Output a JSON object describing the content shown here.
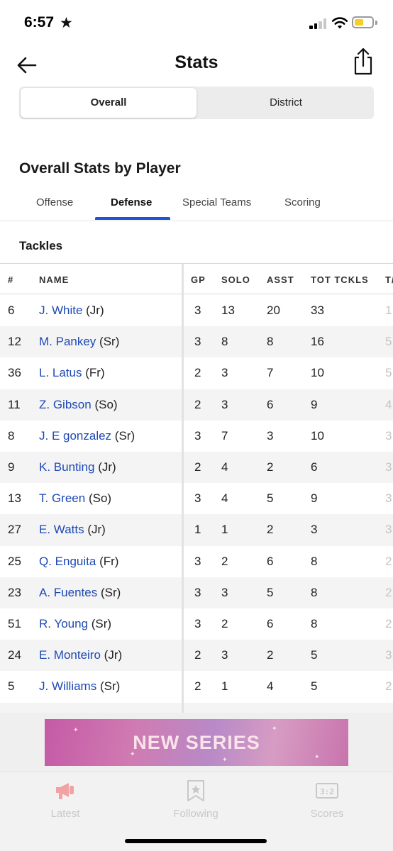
{
  "status": {
    "time": "6:57"
  },
  "nav": {
    "title": "Stats"
  },
  "segments": {
    "active": "Overall",
    "inactive": "District"
  },
  "section_title": "Overall Stats by Player",
  "tabs": [
    {
      "label": "Offense"
    },
    {
      "label": "Defense"
    },
    {
      "label": "Special Teams"
    },
    {
      "label": "Scoring"
    }
  ],
  "subsection": "Tackles",
  "table": {
    "headers": {
      "num": "#",
      "name": "NAME",
      "gp": "GP",
      "solo": "SOLO",
      "asst": "ASST",
      "tot": "TOT TCKLS",
      "clipped": "T/"
    },
    "rows": [
      {
        "num": "6",
        "name": "J. White",
        "yr": "(Jr)",
        "gp": "3",
        "solo": "13",
        "asst": "20",
        "tot": "33",
        "clipped": "1"
      },
      {
        "num": "12",
        "name": "M. Pankey",
        "yr": "(Sr)",
        "gp": "3",
        "solo": "8",
        "asst": "8",
        "tot": "16",
        "clipped": "5"
      },
      {
        "num": "36",
        "name": "L. Latus",
        "yr": "(Fr)",
        "gp": "2",
        "solo": "3",
        "asst": "7",
        "tot": "10",
        "clipped": "5"
      },
      {
        "num": "11",
        "name": "Z. Gibson",
        "yr": "(So)",
        "gp": "2",
        "solo": "3",
        "asst": "6",
        "tot": "9",
        "clipped": "4"
      },
      {
        "num": "8",
        "name": "J. E gonzalez",
        "yr": "(Sr)",
        "gp": "3",
        "solo": "7",
        "asst": "3",
        "tot": "10",
        "clipped": "3"
      },
      {
        "num": "9",
        "name": "K. Bunting",
        "yr": "(Jr)",
        "gp": "2",
        "solo": "4",
        "asst": "2",
        "tot": "6",
        "clipped": "3"
      },
      {
        "num": "13",
        "name": "T. Green",
        "yr": "(So)",
        "gp": "3",
        "solo": "4",
        "asst": "5",
        "tot": "9",
        "clipped": "3"
      },
      {
        "num": "27",
        "name": "E. Watts",
        "yr": "(Jr)",
        "gp": "1",
        "solo": "1",
        "asst": "2",
        "tot": "3",
        "clipped": "3"
      },
      {
        "num": "25",
        "name": "Q. Enguita",
        "yr": "(Fr)",
        "gp": "3",
        "solo": "2",
        "asst": "6",
        "tot": "8",
        "clipped": "2"
      },
      {
        "num": "23",
        "name": "A. Fuentes",
        "yr": "(Sr)",
        "gp": "3",
        "solo": "3",
        "asst": "5",
        "tot": "8",
        "clipped": "2"
      },
      {
        "num": "51",
        "name": "R. Young",
        "yr": "(Sr)",
        "gp": "3",
        "solo": "2",
        "asst": "6",
        "tot": "8",
        "clipped": "2"
      },
      {
        "num": "24",
        "name": "E. Monteiro",
        "yr": "(Jr)",
        "gp": "2",
        "solo": "3",
        "asst": "2",
        "tot": "5",
        "clipped": "3"
      },
      {
        "num": "5",
        "name": "J. Williams",
        "yr": "(Sr)",
        "gp": "2",
        "solo": "1",
        "asst": "4",
        "tot": "5",
        "clipped": "2"
      }
    ]
  },
  "ad": {
    "text": "NEW SERIES"
  },
  "tabbar": [
    {
      "label": "Latest",
      "icon": "megaphone-icon"
    },
    {
      "label": "Following",
      "icon": "star-bookmark-icon"
    },
    {
      "label": "Scores",
      "icon": "scoreboard-icon"
    }
  ],
  "colors": {
    "accent": "#1d55d6",
    "link": "#1d49b4",
    "battery": "#f5cf26",
    "latest_icon": "#f1a3a3"
  }
}
